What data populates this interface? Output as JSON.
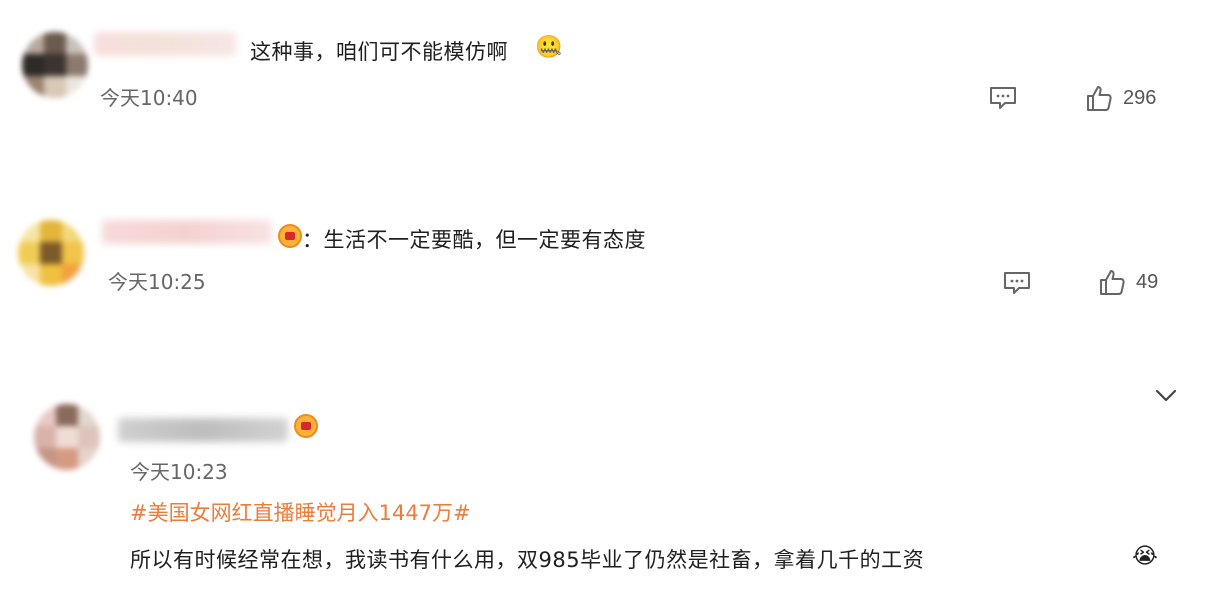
{
  "comments": [
    {
      "text": "这种事，咱们可不能模仿啊",
      "emoji": "🤐",
      "time": "今天10:40",
      "likes": "296"
    },
    {
      "text": "：生活不一定要酷，但一定要有态度",
      "time": "今天10:25",
      "likes": "49"
    },
    {
      "time": "今天10:23",
      "tag": "#美国女网红直播睡觉月入1447万#",
      "text": "所以有时候经常在想，我读书有什么用，双985毕业了仍然是社畜，拿着几千的工资",
      "emoji": "😭"
    }
  ],
  "colors": {
    "tag": "#ee7b3a",
    "icon": "#666666",
    "time": "#666666"
  }
}
